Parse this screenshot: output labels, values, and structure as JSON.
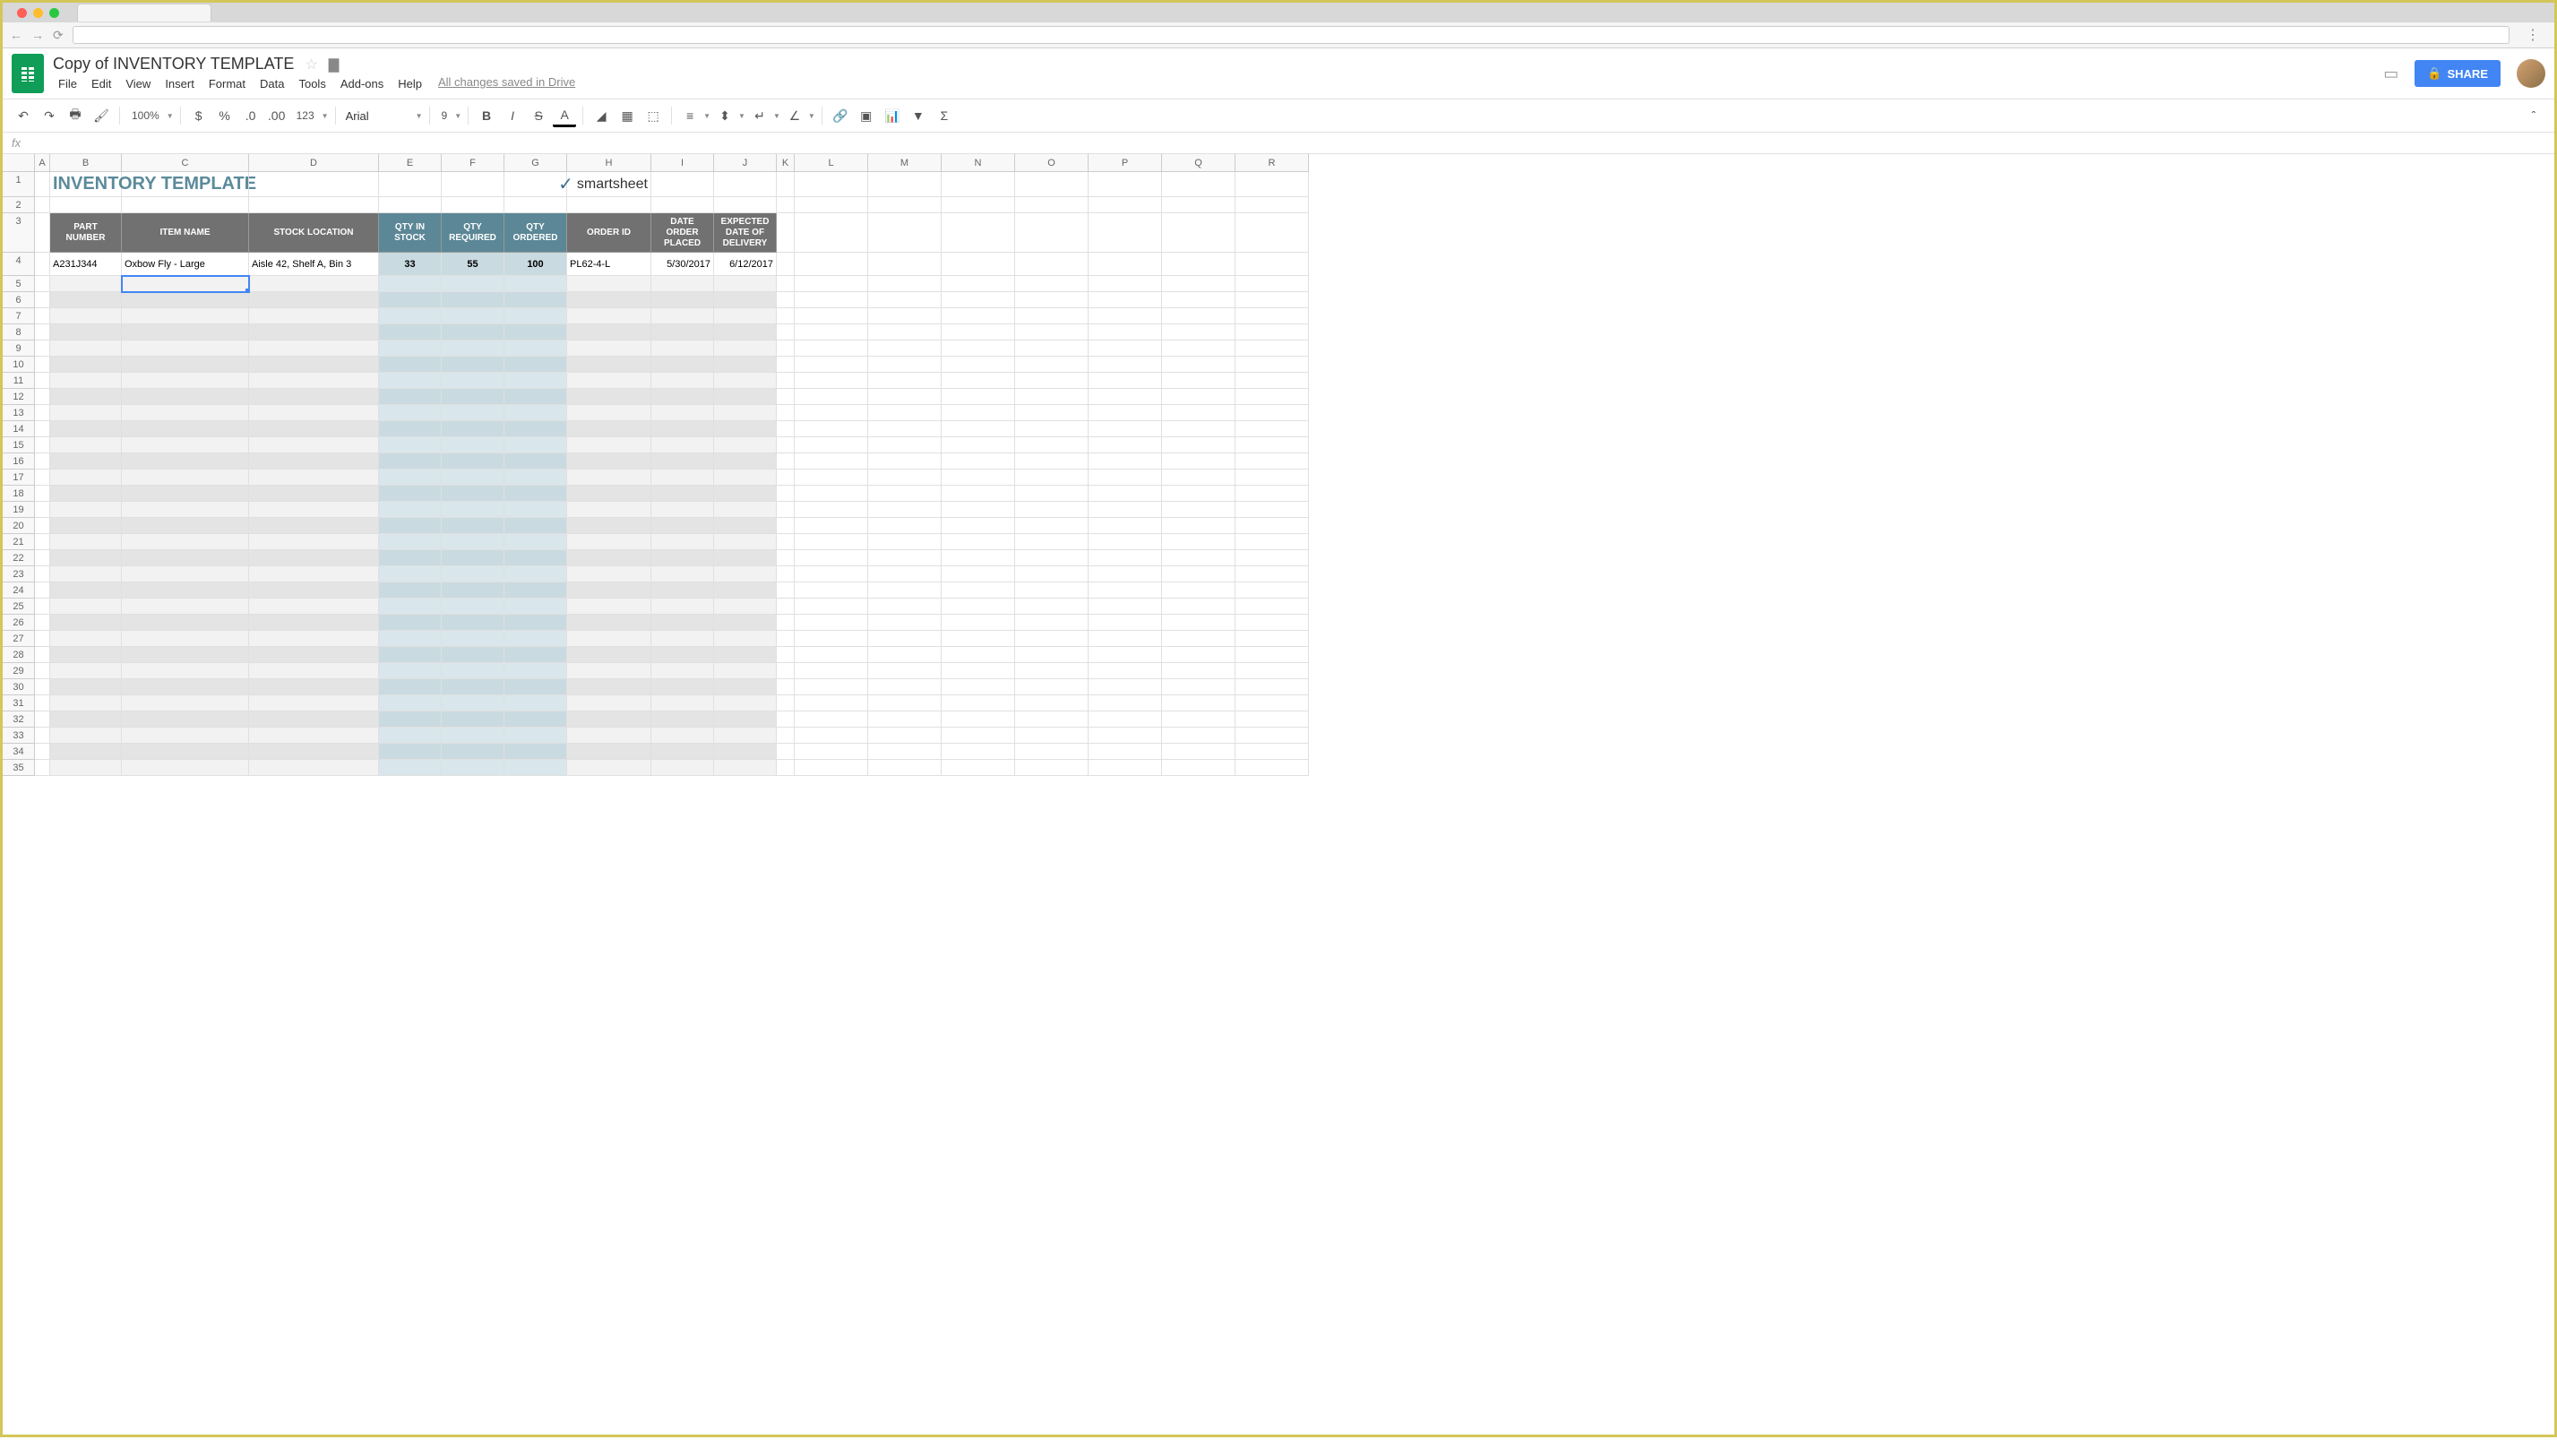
{
  "browser": {
    "url": ""
  },
  "doc": {
    "title": "Copy of INVENTORY TEMPLATE",
    "save_status": "All changes saved in Drive"
  },
  "menus": [
    "File",
    "Edit",
    "View",
    "Insert",
    "Format",
    "Data",
    "Tools",
    "Add-ons",
    "Help"
  ],
  "share_label": "SHARE",
  "toolbar": {
    "zoom": "100%",
    "number_format": "123",
    "font": "Arial",
    "font_size": "9"
  },
  "formula": "",
  "columns": [
    "A",
    "B",
    "C",
    "D",
    "E",
    "F",
    "G",
    "H",
    "I",
    "J",
    "K",
    "L",
    "M",
    "N",
    "O",
    "P",
    "Q",
    "R"
  ],
  "col_widths": [
    "cA",
    "cB",
    "cC",
    "cD",
    "cE",
    "cF",
    "cG",
    "cH",
    "cI",
    "cJ",
    "cK",
    "cL",
    "cM",
    "cN",
    "cO",
    "cP",
    "cQ",
    "cR"
  ],
  "sheet": {
    "title": "INVENTORY TEMPLATE",
    "brand": "smartsheet",
    "headers": [
      "PART NUMBER",
      "ITEM NAME",
      "STOCK LOCATION",
      "QTY IN STOCK",
      "QTY REQUIRED",
      "QTY ORDERED",
      "ORDER ID",
      "DATE ORDER PLACED",
      "EXPECTED DATE OF DELIVERY"
    ],
    "row": {
      "part_number": "A231J344",
      "item_name": "Oxbow Fly - Large",
      "stock_location": "Aisle 42, Shelf A, Bin 3",
      "qty_in_stock": "33",
      "qty_required": "55",
      "qty_ordered": "100",
      "order_id": "PL62-4-L",
      "date_placed": "5/30/2017",
      "date_delivery": "6/12/2017"
    }
  },
  "selected_cell": "C5",
  "row_count": 35
}
